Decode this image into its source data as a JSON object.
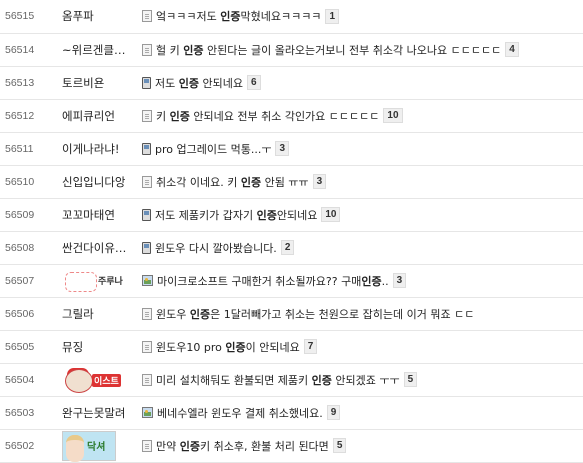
{
  "rows": [
    {
      "num": "56515",
      "author": "옴푸파",
      "icon": "doc-icon",
      "pre": "엌ㅋㅋㅋ저도 ",
      "kw": "인증",
      "post": "막혔네요ㅋㅋㅋㅋ",
      "comments": "1"
    },
    {
      "num": "56514",
      "author": "~위르겐클…",
      "icon": "doc-icon",
      "pre": "헐 키 ",
      "kw": "인증",
      "post": " 안된다는 글이 올라오는거보니 전부 취소각 나오나요 ㄷㄷㄷㄷㄷ",
      "comments": "4"
    },
    {
      "num": "56513",
      "author": "토르비욘",
      "icon": "phone-icon",
      "pre": "저도 ",
      "kw": "인증",
      "post": " 안되네요",
      "comments": "6"
    },
    {
      "num": "56512",
      "author": "에피큐리언",
      "icon": "doc-icon",
      "pre": "키 ",
      "kw": "인증",
      "post": " 안되네요 전부 취소 각인가요 ㄷㄷㄷㄷㄷ",
      "comments": "10"
    },
    {
      "num": "56511",
      "author": "이게나라냐!",
      "icon": "phone-icon",
      "pre": "pro 업그레이드 먹통...ㅜ",
      "kw": "",
      "post": "",
      "comments": "3"
    },
    {
      "num": "56510",
      "author": "신입입니다앙",
      "icon": "doc-icon",
      "pre": "취소각 이네요. 키 ",
      "kw": "인증",
      "post": " 안됨 ㅠㅠ",
      "comments": "3"
    },
    {
      "num": "56509",
      "author": "꼬꼬마태연",
      "icon": "phone-icon",
      "pre": "저도 제품키가 갑자기 ",
      "kw": "인증",
      "post": "안되네요",
      "comments": "10"
    },
    {
      "num": "56508",
      "author": "싼건다이유…",
      "icon": "phone-icon",
      "pre": "윈도우 다시 깔아봤습니다.",
      "kw": "",
      "post": "",
      "comments": "2"
    },
    {
      "num": "56507",
      "author": "주루나",
      "author_img": "doodle",
      "icon": "image-icon",
      "pre": "마이크로소프트 구매한거 취소될까요?? 구매",
      "kw": "인증",
      "post": "..",
      "comments": "3"
    },
    {
      "num": "56506",
      "author": "그릴라",
      "icon": "doc-icon",
      "pre": "윈도우 ",
      "kw": "인증",
      "post": "은 1달러빼가고 취소는 천원으로 잡히는데 이거 뭐죠 ㄷㄷ",
      "comments": ""
    },
    {
      "num": "56505",
      "author": "뮤징",
      "icon": "doc-icon",
      "pre": "윈도우10 pro ",
      "kw": "인증",
      "post": "이 안되네요",
      "comments": "7"
    },
    {
      "num": "56504",
      "author": "이스트",
      "author_img": "boy",
      "icon": "doc-icon",
      "pre": "미리 설치해둬도 환불되면 제품키 ",
      "kw": "인증",
      "post": " 안되겠죠 ㅜㅜ",
      "comments": "5"
    },
    {
      "num": "56503",
      "author": "완구는못말려",
      "icon": "image-icon",
      "pre": "베네수엘라 윈도우 결제 취소했네요.",
      "kw": "",
      "post": "",
      "comments": "9"
    },
    {
      "num": "56502",
      "author": "닥셔",
      "author_img": "girl",
      "icon": "doc-icon",
      "pre": "만약 ",
      "kw": "인증",
      "post": "키 취소후, 환불 처리 된다면",
      "comments": "5"
    }
  ]
}
